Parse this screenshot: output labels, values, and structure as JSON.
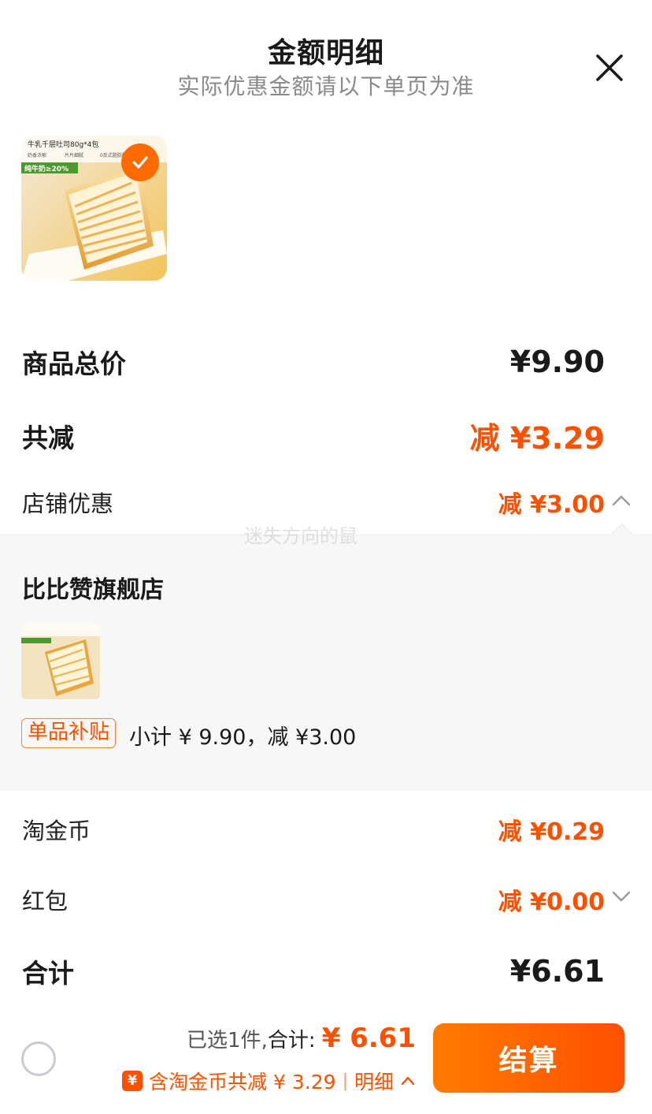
{
  "header": {
    "title": "金额明细",
    "subtitle": "实际优惠金额请以下单页为准"
  },
  "product": {
    "image_text": "牛乳千层吐司80g*4包",
    "tags": [
      "奶香浓郁",
      "片片细腻",
      "0反式脂肪酸"
    ],
    "badge": "纯牛奶≥20%",
    "selected": true
  },
  "summary": {
    "total_label": "商品总价",
    "total_value": "¥9.90",
    "discount_label": "共减",
    "discount_value": "减 ¥3.29",
    "store_discount_label": "店铺优惠",
    "store_discount_value": "减 ¥3.00",
    "coin_label": "淘金币",
    "coin_value": "减 ¥0.29",
    "redpacket_label": "红包",
    "redpacket_value": "减 ¥0.00",
    "sum_label": "合计",
    "sum_value": "¥6.61"
  },
  "store_detail": {
    "store_name": "比比赞旗舰店",
    "subsidy_tag": "单品补贴",
    "subtotal_text": "小计 ¥ 9.90，减 ¥3.00",
    "watermark": "迷失方向的鼠"
  },
  "bottom_bar": {
    "selected_text": "已选1件,",
    "total_label": "合计:",
    "total_amount": "¥ 6.61",
    "coin_icon": "¥",
    "coin_detail": "含淘金币共减 ¥ 3.29",
    "separator": "|",
    "detail_link": "明细",
    "checkout_label": "结算"
  },
  "colors": {
    "accent": "#ff5000",
    "button_gradient_start": "#ff7b00",
    "button_gradient_end": "#ff5000"
  }
}
